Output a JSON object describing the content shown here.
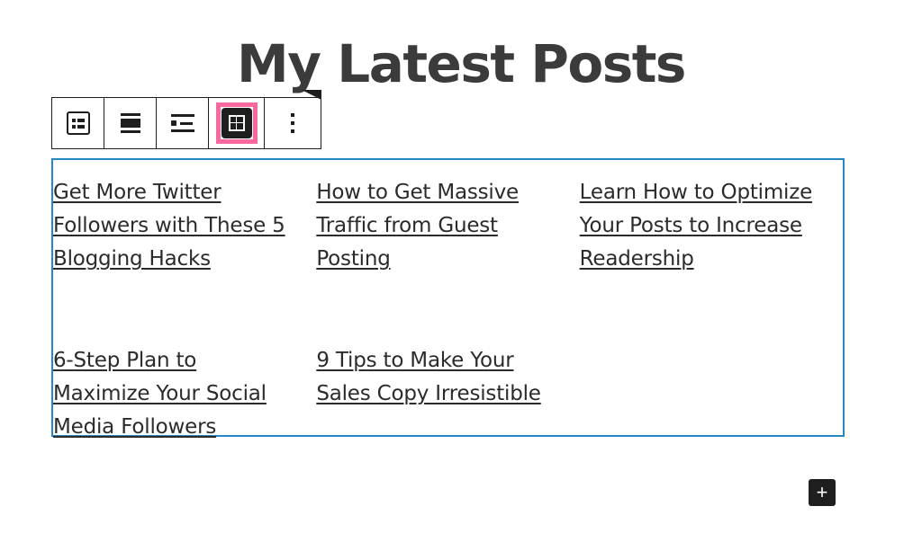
{
  "page": {
    "title": "My Latest Posts",
    "title_color": "#3b3b3b",
    "background": "#ffffff"
  },
  "toolbar": {
    "selection_ring_color": "#f9699f",
    "border_color": "#1e1e1e",
    "buttons": [
      {
        "icon": "latest-posts-block-icon",
        "label": "Latest Posts",
        "selected": false
      },
      {
        "icon": "align-center-icon",
        "label": "Change alignment",
        "selected": false
      },
      {
        "icon": "list-view-icon",
        "label": "List view",
        "selected": false
      },
      {
        "icon": "grid-view-icon",
        "label": "Grid view",
        "selected": true
      },
      {
        "icon": "more-options-icon",
        "label": "Options",
        "selected": false
      }
    ]
  },
  "posts_block": {
    "view": "grid",
    "columns": 3,
    "selected": true,
    "selection_border_color": "#2589c5",
    "link_color": "#2b2b2b",
    "posts": [
      {
        "title": "Get More Twitter Followers with These 5 Blogging Hacks"
      },
      {
        "title": "How to Get Massive Traffic from Guest Posting"
      },
      {
        "title": "Learn How to Optimize Your Posts to Increase Readership"
      },
      {
        "title": "6-Step Plan to Maximize Your Social Media Followers"
      },
      {
        "title": "9 Tips to Make Your Sales Copy Irresistible"
      }
    ]
  },
  "add_block": {
    "label": "+",
    "background": "#1e1e1e"
  }
}
